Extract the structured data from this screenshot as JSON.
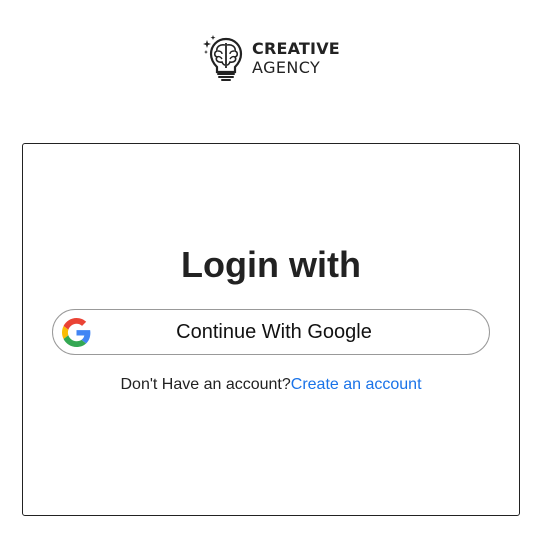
{
  "brand": {
    "name_line1": "CREATIVE",
    "name_line2": "AGENCY",
    "logo_icon": "lightbulb-brain-icon"
  },
  "login": {
    "heading": "Login with",
    "google_button_label": "Continue With Google",
    "google_icon": "google-icon",
    "no_account_text": "Don't Have an account?",
    "create_account_link": "Create an account"
  },
  "colors": {
    "text": "#222222",
    "link": "#1a73e8",
    "button_border": "#999999",
    "card_border": "#222222"
  }
}
